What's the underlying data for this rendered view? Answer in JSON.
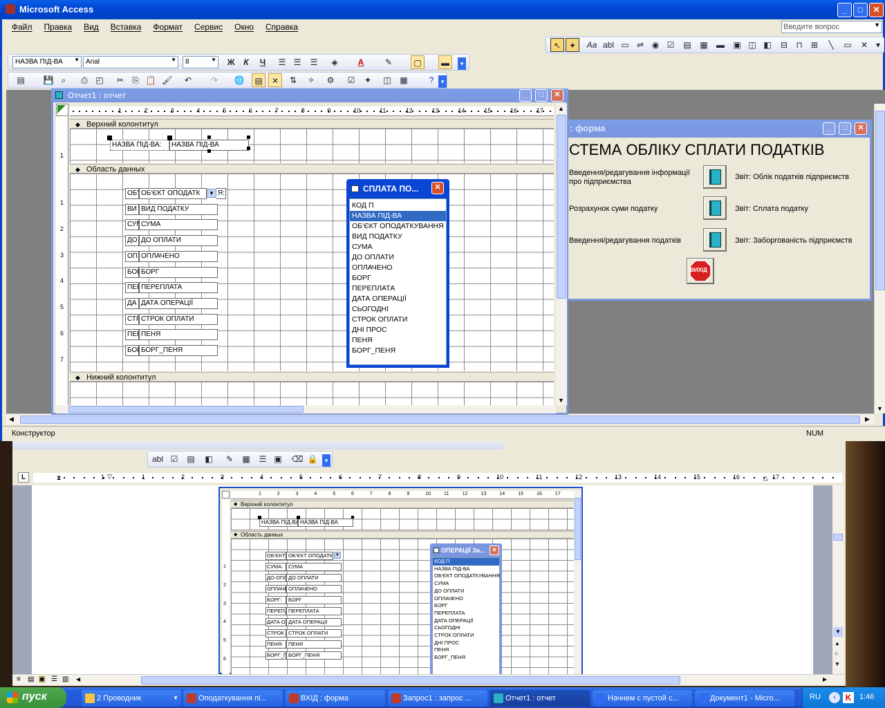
{
  "app": {
    "title": "Microsoft Access",
    "menu": [
      "Файл",
      "Правка",
      "Вид",
      "Вставка",
      "Формат",
      "Сервис",
      "Окно",
      "Справка"
    ],
    "help_placeholder": "Введите вопрос",
    "status_left": "Конструктор",
    "status_num": "NUM"
  },
  "format_toolbar": {
    "object": "НАЗВА ПІД-ВА",
    "font": "Arial",
    "size": "8",
    "bold": "Ж",
    "italic": "К",
    "underline": "Ч"
  },
  "report_window": {
    "title": "Отчет1 : отчет",
    "ruler_marks": [
      "1",
      "2",
      "3",
      "4",
      "5",
      "6",
      "7",
      "8",
      "9",
      "10",
      "11",
      "12",
      "13",
      "14",
      "15",
      "16",
      "17",
      "18"
    ],
    "sections": {
      "header": "Верхний колонтитул",
      "detail": "Область данных",
      "footer": "Нижний колонтитул"
    },
    "header_label": "НАЗВА ПІД-ВА:",
    "header_field": "НАЗВА ПІД-ВА",
    "row_labels": [
      "ОБ'",
      "ВИ",
      "СУМ",
      "ДО",
      "ОП",
      "БОР",
      "ПЕР",
      "ДА",
      "СТР",
      "ПЕН",
      "БОР"
    ],
    "row_fields": [
      "ОБ'ЄКТ ОПОДАТК",
      "ВИД ПОДАТКУ",
      "СУМА",
      "ДО ОПЛАТИ",
      "ОПЛАЧЕНО",
      "БОРГ",
      "ПЕРЕПЛАТА",
      "ДАТА ОПЕРАЦІЇ",
      "СТРОК ОПЛАТИ",
      "ПЕНЯ",
      "БОРГ_ПЕНЯ"
    ],
    "combo_tail": "Я:",
    "vruler": [
      "1",
      "2",
      "3",
      "4",
      "5",
      "6",
      "7"
    ]
  },
  "field_list": {
    "title": "СПЛАТА ПО...",
    "items": [
      "КОД П",
      "НАЗВА ПІД-ВА",
      "ОБ'ЄКТ ОПОДАТКУВАННЯ",
      "ВИД ПОДАТКУ",
      "СУМА",
      "ДО ОПЛАТИ",
      "ОПЛАЧЕНО",
      "БОРГ",
      "ПЕРЕПЛАТА",
      "ДАТА ОПЕРАЦІЇ",
      "СЬОГОДНІ",
      "СТРОК ОПЛАТИ",
      "ДНІ ПРОС",
      "ПЕНЯ",
      "БОРГ_ПЕНЯ"
    ],
    "selected": 1
  },
  "form_window": {
    "title": ": форма",
    "heading": "СТЕМА ОБЛІКУ СПЛАТИ ПОДАТКІВ",
    "left_labels": [
      "Введення/редагування інформації про підприємства",
      "Розрахунок суми податку",
      "Введення/редагування податків"
    ],
    "right_labels": [
      "Звіт: Облік податків підприємств",
      "Звіт: Сплата податку",
      "Звіт: Заборгованість підприємств"
    ],
    "exit_label": "ВИХІД"
  },
  "word": {
    "ruler_marks": [
      "1",
      "1",
      "2",
      "3",
      "4",
      "5",
      "6",
      "7",
      "8",
      "9",
      "10",
      "11",
      "12",
      "13",
      "14",
      "15",
      "16",
      "17",
      "19"
    ],
    "tab_marker": "L",
    "inner": {
      "section_header": "Верхний колонтитул",
      "section_detail": "Область данных",
      "header_label": "НАЗВА ПІД-ВА",
      "header_field": "НАЗВА ПІД-ВА",
      "row_labels": [
        "ОБ'ЄКТ",
        "СУМА:",
        "ДО ОПЛ",
        "ОПЛАЧЕ",
        "БОРГ:",
        "ПЕРЕПЛ",
        "ДАТА О",
        "СТРОК",
        "ПЕНЯ:",
        "БОРГ_П"
      ],
      "row_fields": [
        "ОБ'ЄКТ ОПОДАТК",
        "СУМА",
        "ДО ОПЛАТИ",
        "ОПЛАЧЕНО",
        "БОРГ",
        "ПЕРЕПЛАТА",
        "ДАТА ОПЕРАЦІЇ",
        "СТРОК ОПЛАТИ",
        "ПЕНЯ",
        "БОРГ_ПЕНЯ"
      ],
      "list_title": "ОПЕРАЦІЇ За...",
      "list_items": [
        "КОД П",
        "НАЗВА ПІД-ВА",
        "ОБ'ЄКТ ОПОДАТКУВАННЯ",
        "СУМА",
        "ДО ОПЛАТИ",
        "ОПЛАЧЕНО",
        "БОРГ",
        "ПЕРЕПЛАТА",
        "ДАТА ОПЕРАЦІЇ",
        "СЬОГОДНІ",
        "СТРОК ОПЛАТИ",
        "ДНІ ПРОС",
        "ПЕНЯ",
        "БОРГ_ПЕНЯ"
      ],
      "ruler_marks": [
        "1",
        "2",
        "3",
        "4",
        "5",
        "6",
        "7",
        "8",
        "9",
        "10",
        "11",
        "12",
        "13",
        "14",
        "15",
        "16",
        "17",
        "18"
      ],
      "vruler": [
        "1",
        "2",
        "3",
        "4",
        "5",
        "6"
      ]
    }
  },
  "taskbar": {
    "start": "пуск",
    "items": [
      "2 Проводник",
      "Оподаткування пі...",
      "ВХІД : форма",
      "Запрос1 : запрос ...",
      "Отчет1 : отчет",
      "Начнем с пустой с...",
      "Документ1 - Micro..."
    ],
    "active_index": 4,
    "lang": "RU",
    "time": "1:46"
  }
}
